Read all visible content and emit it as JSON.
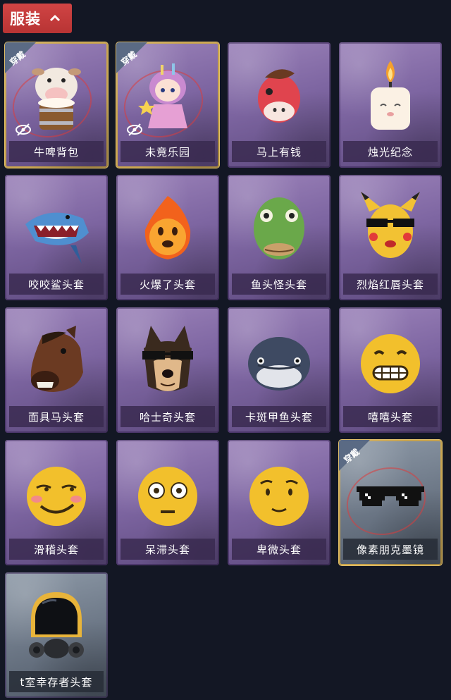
{
  "section": {
    "title": "服装",
    "toggle_icon": "chevron-up-icon"
  },
  "equipped_tag": "穿戴",
  "items": [
    {
      "label": "牛啤背包",
      "equipped": true,
      "hidden_icon": "eye-slash-icon",
      "icon": "cow-beer-backpack-icon"
    },
    {
      "label": "未竟乐园",
      "equipped": true,
      "hidden_icon": "eye-slash-icon",
      "icon": "girl-figure-icon"
    },
    {
      "label": "马上有钱",
      "equipped": false,
      "icon": "red-horse-icon"
    },
    {
      "label": "烛光纪念",
      "equipped": false,
      "icon": "candle-icon"
    },
    {
      "label": "咬咬鲨头套",
      "equipped": false,
      "icon": "shark-head-icon"
    },
    {
      "label": "火爆了头套",
      "equipped": false,
      "icon": "fire-head-icon"
    },
    {
      "label": "鱼头怪头套",
      "equipped": false,
      "icon": "fish-head-icon"
    },
    {
      "label": "烈焰红唇头套",
      "equipped": false,
      "icon": "pikachu-head-icon"
    },
    {
      "label": "面具马头套",
      "equipped": false,
      "icon": "horse-mask-icon"
    },
    {
      "label": "哈士奇头套",
      "equipped": false,
      "icon": "husky-head-icon"
    },
    {
      "label": "卡斑甲鱼头套",
      "equipped": false,
      "icon": "turtle-head-icon"
    },
    {
      "label": "嘻嘻头套",
      "equipped": false,
      "icon": "grin-emoji-icon"
    },
    {
      "label": "滑稽头套",
      "equipped": false,
      "icon": "smirk-emoji-icon"
    },
    {
      "label": "呆滞头套",
      "equipped": false,
      "icon": "stunned-emoji-icon"
    },
    {
      "label": "卑微头套",
      "equipped": false,
      "icon": "humble-emoji-icon"
    },
    {
      "label": "像素朋克墨镜",
      "equipped": true,
      "icon": "pixel-sunglasses-icon"
    },
    {
      "label": "t室幸存者头套",
      "equipped": false,
      "icon": "gas-mask-helmet-icon"
    }
  ],
  "colors": {
    "background": "#131724",
    "header_red": "#c23a3a",
    "card_purple": "#8a70ac",
    "card_gray": "#6d7887",
    "equipped_gold": "#d4b15c"
  }
}
